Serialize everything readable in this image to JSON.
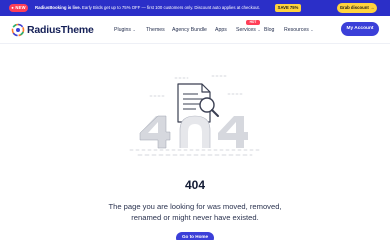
{
  "promo": {
    "badge": "● NEW",
    "text_bold": "RadiusBooking is live.",
    "text": " Early Birds get up to 75% OFF — first 100 customers only. Discount auto applies at checkout.",
    "code": "SAVE 75%",
    "cta": "Grab discount →"
  },
  "header": {
    "brand": "RadiusTheme",
    "nav": {
      "plugins": "Plugins",
      "themes": "Themes",
      "agency": "Agency Bundle",
      "apps": "Apps",
      "services": "Services",
      "blog": "Blog",
      "resources": "Resources"
    },
    "hot_badge": "HOT",
    "my_account": "My Account"
  },
  "error": {
    "code": "404",
    "message": "The page you are looking for was moved, removed, renamed or might never have existed.",
    "home_button": "Go to Home"
  },
  "colors": {
    "promo_bg": "#2b2fc8",
    "accent": "#3b3fd8",
    "badge_red": "#ff3e57",
    "code_yellow": "#ffd33d"
  },
  "icons": {
    "logo": "radiustheme-logo-icon",
    "dropdown": "chevron-down-icon",
    "illustration": "404-document-magnifier-illustration"
  }
}
